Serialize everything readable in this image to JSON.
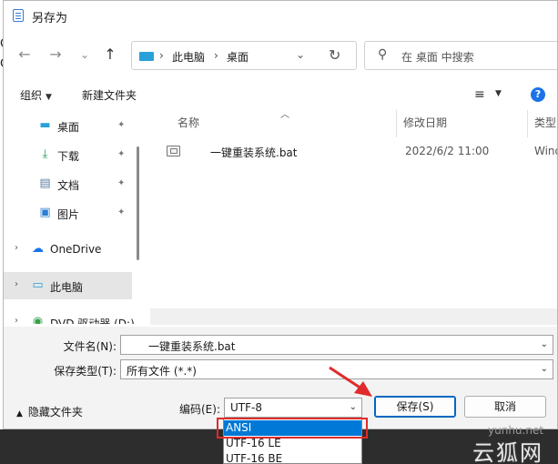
{
  "window": {
    "title": "另存为"
  },
  "background_chars": [
    "C",
    "C"
  ],
  "nav": {
    "back": "←",
    "forward": "→",
    "history": "⌄",
    "up": "↑",
    "breadcrumb": [
      "此电脑",
      "桌面"
    ],
    "breadcrumb_sep": "›",
    "dropdown": "⌄",
    "refresh": "↻",
    "search_placeholder": "在 桌面 中搜索",
    "search_icon": "⚲"
  },
  "toolbar": {
    "organize": "组织",
    "new_folder": "新建文件夹",
    "caret": "▼",
    "view_icon": "≡",
    "help": "?"
  },
  "sidebar": {
    "items": [
      {
        "label": "桌面",
        "icon": "desktop-icon",
        "glyph": "▬",
        "color": "#2aa0d8",
        "pinned": true
      },
      {
        "label": "下载",
        "icon": "download-icon",
        "glyph": "⤓",
        "color": "#1f9d55",
        "pinned": true
      },
      {
        "label": "文档",
        "icon": "document-icon",
        "glyph": "▤",
        "color": "#5b7fa6",
        "pinned": true
      },
      {
        "label": "图片",
        "icon": "picture-icon",
        "glyph": "▣",
        "color": "#2a7fd4",
        "pinned": true
      },
      {
        "label": "OneDrive",
        "icon": "cloud-icon",
        "glyph": "☁",
        "color": "#1a73e8",
        "pinned": false
      },
      {
        "label": "此电脑",
        "icon": "computer-icon",
        "glyph": "▭",
        "color": "#2aa0d8",
        "pinned": false
      },
      {
        "label": "DVD 驱动器 (D:)",
        "icon": "dvd-icon",
        "glyph": "◉",
        "color": "#3aa04a",
        "pinned": false
      }
    ],
    "pin_glyph": "📌",
    "chevron": "›"
  },
  "filelist": {
    "columns": [
      "名称",
      "修改日期",
      "类型"
    ],
    "sort_glyph": "︿",
    "rows": [
      {
        "name": "一键重装系统.bat",
        "modified": "2022/6/2 11:00",
        "type": "Wind"
      }
    ]
  },
  "form": {
    "filename_label": "文件名(N):",
    "filename_value": "一键重装系统.bat",
    "filetype_label": "保存类型(T):",
    "filetype_value": "所有文件 (*.*)",
    "encoding_label": "编码(E):",
    "encoding_value": "UTF-8",
    "dd_glyph": "⌄",
    "hide_folders": "隐藏文件夹",
    "hide_caret": "▲",
    "save": "保存(S)",
    "cancel": "取消"
  },
  "encoding_options": {
    "items": [
      "ANSI",
      "UTF-16 LE",
      "UTF-16 BE"
    ],
    "highlighted": "ANSI"
  },
  "watermark": {
    "url": "yunhu.net",
    "brand": "云狐网"
  },
  "colors": {
    "accent": "#0067c0",
    "highlight": "#0078d7",
    "annotation": "#e02b2b"
  }
}
